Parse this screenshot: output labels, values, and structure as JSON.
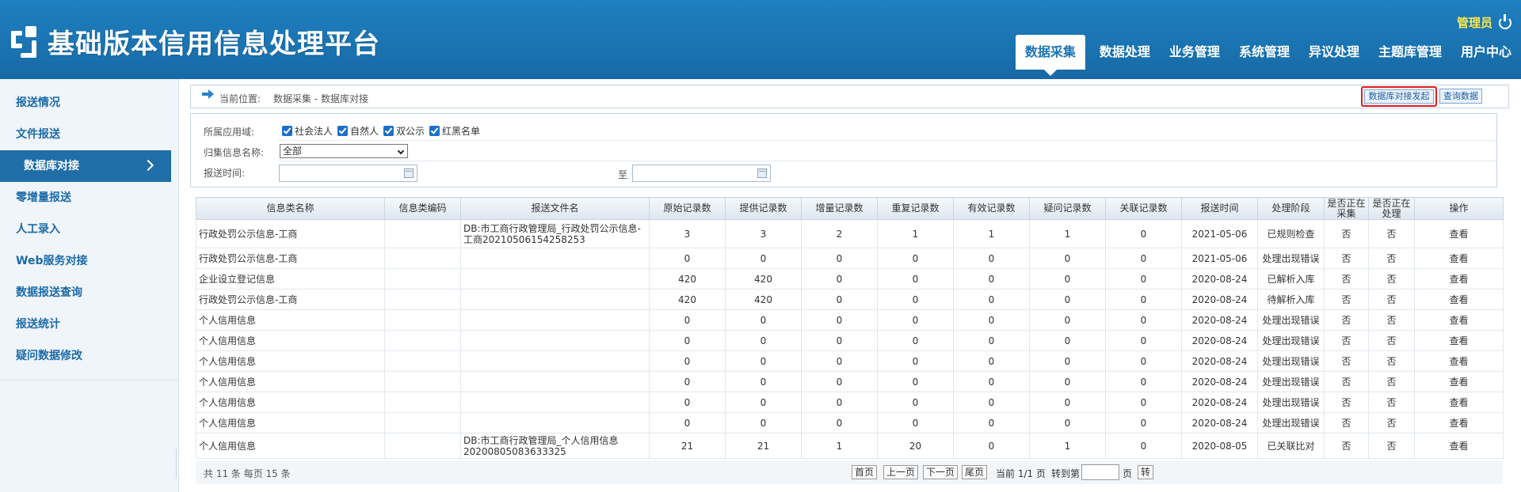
{
  "header": {
    "title": "基础版本信用信息处理平台",
    "admin": "管理员",
    "nav": [
      "数据采集",
      "数据处理",
      "业务管理",
      "系统管理",
      "异议处理",
      "主题库管理",
      "用户中心"
    ]
  },
  "sidebar": {
    "items": [
      "报送情况",
      "文件报送",
      "数据库对接",
      "零增量报送",
      "人工录入",
      "Web服务对接",
      "数据报送查询",
      "报送统计",
      "疑问数据修改"
    ]
  },
  "breadcrumb": {
    "label": "当前位置:",
    "path": "数据采集 - 数据库对接",
    "launch_button": "数据库对接发起",
    "query_button": "查询数据"
  },
  "filter": {
    "domain_label": "所属应用域:",
    "domains": [
      "社会法人",
      "自然人",
      "双公示",
      "红黑名单"
    ],
    "category_label": "归集信息名称:",
    "category_value": "全部",
    "time_label": "报送时间:",
    "to_label": "至"
  },
  "table": {
    "headers": [
      "信息类名称",
      "信息类编码",
      "报送文件名",
      "原始记录数",
      "提供记录数",
      "增量记录数",
      "重复记录数",
      "有效记录数",
      "疑问记录数",
      "关联记录数",
      "报送时间",
      "处理阶段",
      "是否正在采集",
      "是否正在处理",
      "操作"
    ],
    "rows": [
      [
        "行政处罚公示信息-工商",
        "",
        "DB:市工商行政管理局_行政处罚公示信息-工商20210506154258253",
        "3",
        "3",
        "2",
        "1",
        "1",
        "1",
        "0",
        "2021-05-06",
        "已规则检查",
        "否",
        "否",
        "查看"
      ],
      [
        "行政处罚公示信息-工商",
        "",
        "",
        "0",
        "0",
        "0",
        "0",
        "0",
        "0",
        "0",
        "2021-05-06",
        "处理出现错误",
        "否",
        "否",
        "查看"
      ],
      [
        "企业设立登记信息",
        "",
        "",
        "420",
        "420",
        "0",
        "0",
        "0",
        "0",
        "0",
        "2020-08-24",
        "已解析入库",
        "否",
        "否",
        "查看"
      ],
      [
        "行政处罚公示信息-工商",
        "",
        "",
        "420",
        "420",
        "0",
        "0",
        "0",
        "0",
        "0",
        "2020-08-24",
        "待解析入库",
        "否",
        "否",
        "查看"
      ],
      [
        "个人信用信息",
        "",
        "",
        "0",
        "0",
        "0",
        "0",
        "0",
        "0",
        "0",
        "2020-08-24",
        "处理出现错误",
        "否",
        "否",
        "查看"
      ],
      [
        "个人信用信息",
        "",
        "",
        "0",
        "0",
        "0",
        "0",
        "0",
        "0",
        "0",
        "2020-08-24",
        "处理出现错误",
        "否",
        "否",
        "查看"
      ],
      [
        "个人信用信息",
        "",
        "",
        "0",
        "0",
        "0",
        "0",
        "0",
        "0",
        "0",
        "2020-08-24",
        "处理出现错误",
        "否",
        "否",
        "查看"
      ],
      [
        "个人信用信息",
        "",
        "",
        "0",
        "0",
        "0",
        "0",
        "0",
        "0",
        "0",
        "2020-08-24",
        "处理出现错误",
        "否",
        "否",
        "查看"
      ],
      [
        "个人信用信息",
        "",
        "",
        "0",
        "0",
        "0",
        "0",
        "0",
        "0",
        "0",
        "2020-08-24",
        "处理出现错误",
        "否",
        "否",
        "查看"
      ],
      [
        "个人信用信息",
        "",
        "",
        "0",
        "0",
        "0",
        "0",
        "0",
        "0",
        "0",
        "2020-08-24",
        "处理出现错误",
        "否",
        "否",
        "查看"
      ],
      [
        "个人信用信息",
        "",
        "DB:市工商行政管理局_个人信用信息20200805083633325",
        "21",
        "21",
        "1",
        "20",
        "0",
        "1",
        "0",
        "2020-08-05",
        "已关联比对",
        "否",
        "否",
        "查看"
      ]
    ]
  },
  "pager": {
    "total": "共 11 条  每页 15 条",
    "first": "首页",
    "prev": "上一页",
    "next": "下一页",
    "last": "尾页",
    "current": "当前 1/1 页",
    "goto": "转到第",
    "page_unit": "页",
    "go": "转"
  }
}
